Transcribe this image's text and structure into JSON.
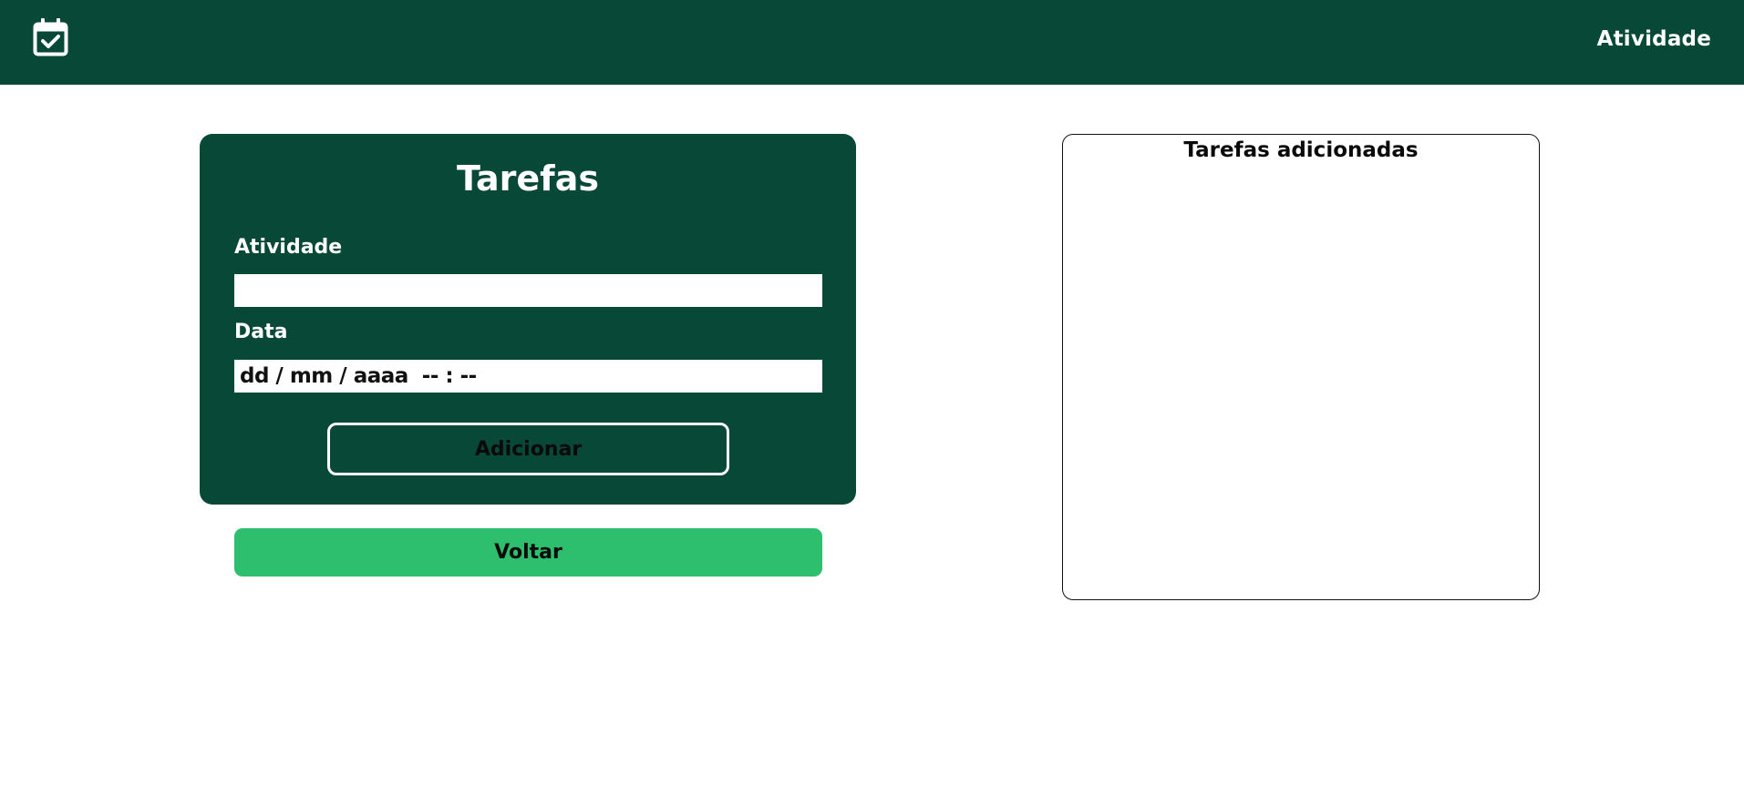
{
  "header": {
    "logo_icon": "calendar-check-icon",
    "nav_link": "Atividade",
    "background": "#074836"
  },
  "form": {
    "title": "Tarefas",
    "atividade_label": "Atividade",
    "atividade_value": "",
    "data_label": "Data",
    "data_placeholder": "dd / mm / aaaa  -- : --",
    "add_button": "Adicionar",
    "card_color": "#074836"
  },
  "back_button": {
    "label": "Voltar",
    "color": "#2ebf6e"
  },
  "tasks_panel": {
    "title": "Tarefas adicionadas",
    "items": []
  }
}
